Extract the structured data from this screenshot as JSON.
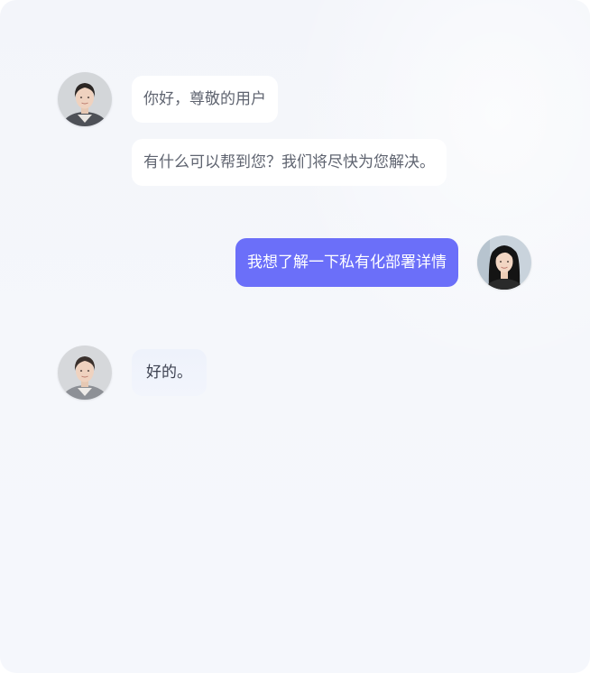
{
  "chat": {
    "messages": [
      {
        "sender": "agent",
        "avatar": "agent-avatar-woman",
        "text": "你好，尊敬的用户"
      },
      {
        "sender": "agent",
        "avatar": null,
        "text": "有什么可以帮到您？我们将尽快为您解决。"
      },
      {
        "sender": "user",
        "avatar": "user-avatar-woman",
        "text": "我想了解一下私有化部署详情"
      },
      {
        "sender": "agent",
        "avatar": "agent-avatar-woman",
        "text": "好的。"
      }
    ]
  },
  "colors": {
    "background": "#f4f6fb",
    "agent_bubble": "#ffffff",
    "user_bubble": "#6b6ff9",
    "agent_text": "#5f6470",
    "user_text": "#ffffff"
  }
}
